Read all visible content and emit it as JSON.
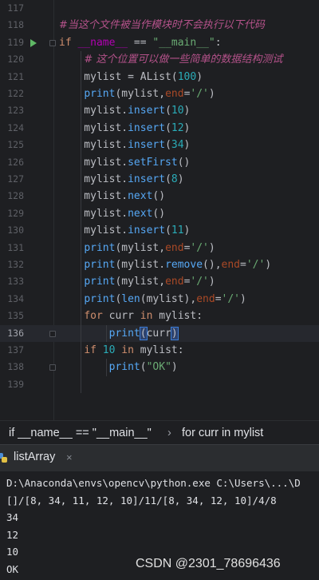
{
  "editor": {
    "lines": [
      {
        "n": "117",
        "html": ""
      },
      {
        "n": "118",
        "html": "<span class=\"cmt\">#当这个文件被当作模块时不会执行以下代码</span>"
      },
      {
        "n": "119",
        "html": "<span class=\"kw\">if</span> <span class=\"dunder\">__name__</span> == <span class=\"str\">\"__main__\"</span>:"
      },
      {
        "n": "120",
        "html": "    <span class=\"cmt\"># 这个位置可以做一些简单的数据结构测试</span>"
      },
      {
        "n": "121",
        "html": "    mylist = AList(<span class=\"num\">100</span>)"
      },
      {
        "n": "122",
        "html": "    <span class=\"fn\">print</span>(mylist,<span class=\"param\">end</span>=<span class=\"str\">'/'</span>)"
      },
      {
        "n": "123",
        "html": "    mylist.<span class=\"fn\">insert</span>(<span class=\"num\">10</span>)"
      },
      {
        "n": "124",
        "html": "    mylist.<span class=\"fn\">insert</span>(<span class=\"num\">12</span>)"
      },
      {
        "n": "125",
        "html": "    mylist.<span class=\"fn\">insert</span>(<span class=\"num\">34</span>)"
      },
      {
        "n": "126",
        "html": "    mylist.<span class=\"fn\">setFirst</span>()"
      },
      {
        "n": "127",
        "html": "    mylist.<span class=\"fn\">insert</span>(<span class=\"num\">8</span>)"
      },
      {
        "n": "128",
        "html": "    mylist.<span class=\"fn\">next</span>()"
      },
      {
        "n": "129",
        "html": "    mylist.<span class=\"fn\">next</span>()"
      },
      {
        "n": "130",
        "html": "    mylist.<span class=\"fn\">insert</span>(<span class=\"num\">11</span>)"
      },
      {
        "n": "131",
        "html": "    <span class=\"fn\">print</span>(mylist,<span class=\"param\">end</span>=<span class=\"str\">'/'</span>)"
      },
      {
        "n": "132",
        "html": "    <span class=\"fn\">print</span>(mylist.<span class=\"fn\">remove</span>(),<span class=\"param\">end</span>=<span class=\"str\">'/'</span>)"
      },
      {
        "n": "133",
        "html": "    <span class=\"fn\">print</span>(mylist,<span class=\"param\">end</span>=<span class=\"str\">'/'</span>)"
      },
      {
        "n": "134",
        "html": "    <span class=\"fn\">print</span>(<span class=\"fn\">len</span>(mylist),<span class=\"param\">end</span>=<span class=\"str\">'/'</span>)"
      },
      {
        "n": "135",
        "html": "    <span class=\"kw\">for</span> curr <span class=\"kw\">in</span> mylist:"
      },
      {
        "n": "136",
        "html": "        <span class=\"fn\">print</span><span class=\"bracket\">(</span>curr<span class=\"bracket\">)</span>"
      },
      {
        "n": "137",
        "html": "    <span class=\"kw\">if</span> <span class=\"num\">10</span> <span class=\"kw\">in</span> mylist:"
      },
      {
        "n": "138",
        "html": "        <span class=\"fn\">print</span>(<span class=\"str\">\"OK\"</span>)"
      },
      {
        "n": "139",
        "html": ""
      }
    ],
    "current_line": "136"
  },
  "breadcrumb": {
    "item1": "if __name__ == \"__main__\"",
    "separator": "›",
    "item2": "for curr in mylist"
  },
  "run": {
    "tab_label": "listArray",
    "close_glyph": "×",
    "icon": "python-icon"
  },
  "console": {
    "lines": [
      "D:\\Anaconda\\envs\\opencv\\python.exe C:\\Users\\...\\D",
      "[]/[8, 34, 11, 12, 10]/11/[8, 34, 12, 10]/4/8",
      "34",
      "12",
      "10",
      "OK"
    ]
  },
  "watermark": "CSDN @2301_78696436",
  "colors": {
    "background": "#1e1f22",
    "keyword": "#cf8e6d",
    "function": "#56a8f5",
    "number": "#2aacb8",
    "string": "#6aab73",
    "comment": "#b4528a"
  }
}
